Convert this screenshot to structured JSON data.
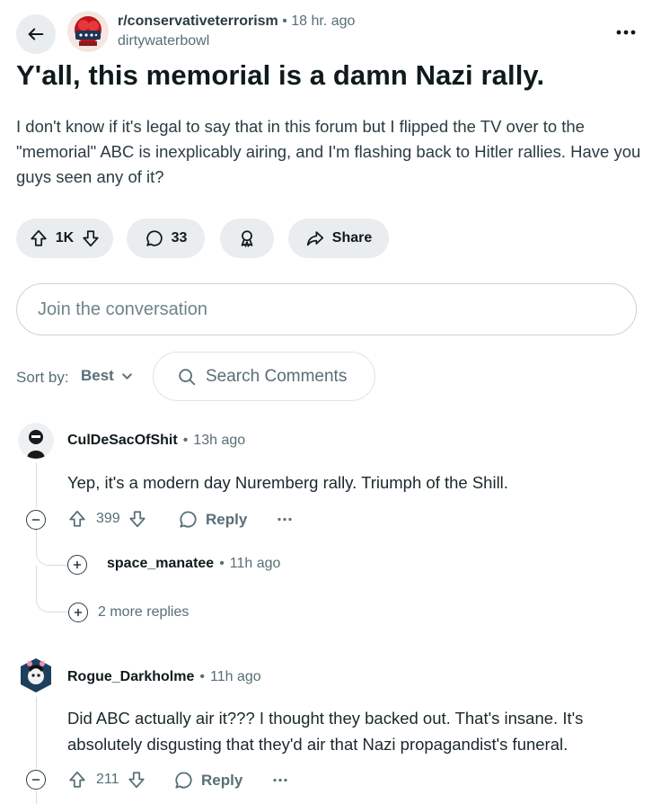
{
  "header": {
    "subreddit": "r/conservativeterrorism",
    "separator": "•",
    "time": "18 hr. ago",
    "author": "dirtywaterbowl"
  },
  "post": {
    "title": "Y'all, this memorial is a damn Nazi rally.",
    "body": "I don't know if it's legal to say that in this forum but I flipped the TV over to the \"memorial\" ABC is inexplicably airing, and I'm flashing back to Hitler rallies. Have you guys seen any of it?"
  },
  "actions": {
    "votes": "1K",
    "comments": "33",
    "share": "Share"
  },
  "join": {
    "placeholder": "Join the conversation"
  },
  "sort": {
    "label": "Sort by:",
    "value": "Best"
  },
  "search": {
    "placeholder": "Search Comments"
  },
  "comments": [
    {
      "author": "CulDeSacOfShit",
      "time": "13h ago",
      "body": "Yep, it's a modern day Nuremberg rally. Triumph of the Shill.",
      "votes": "399",
      "reply": "Reply",
      "replies": [
        {
          "author": "space_manatee",
          "time": "11h ago"
        }
      ],
      "more_replies": "2 more replies"
    },
    {
      "author": "Rogue_Darkholme",
      "time": "11h ago",
      "body": "Did ABC actually air it??? I thought they backed out. That's insane. It's absolutely disgusting that they'd air that Nazi propagandist's funeral.",
      "votes": "211",
      "reply": "Reply"
    }
  ],
  "colors": {
    "pill_bg": "#e9edf0",
    "text_primary": "#0f1a1c",
    "text_meta": "#576f76",
    "border": "#cbd3d6"
  }
}
